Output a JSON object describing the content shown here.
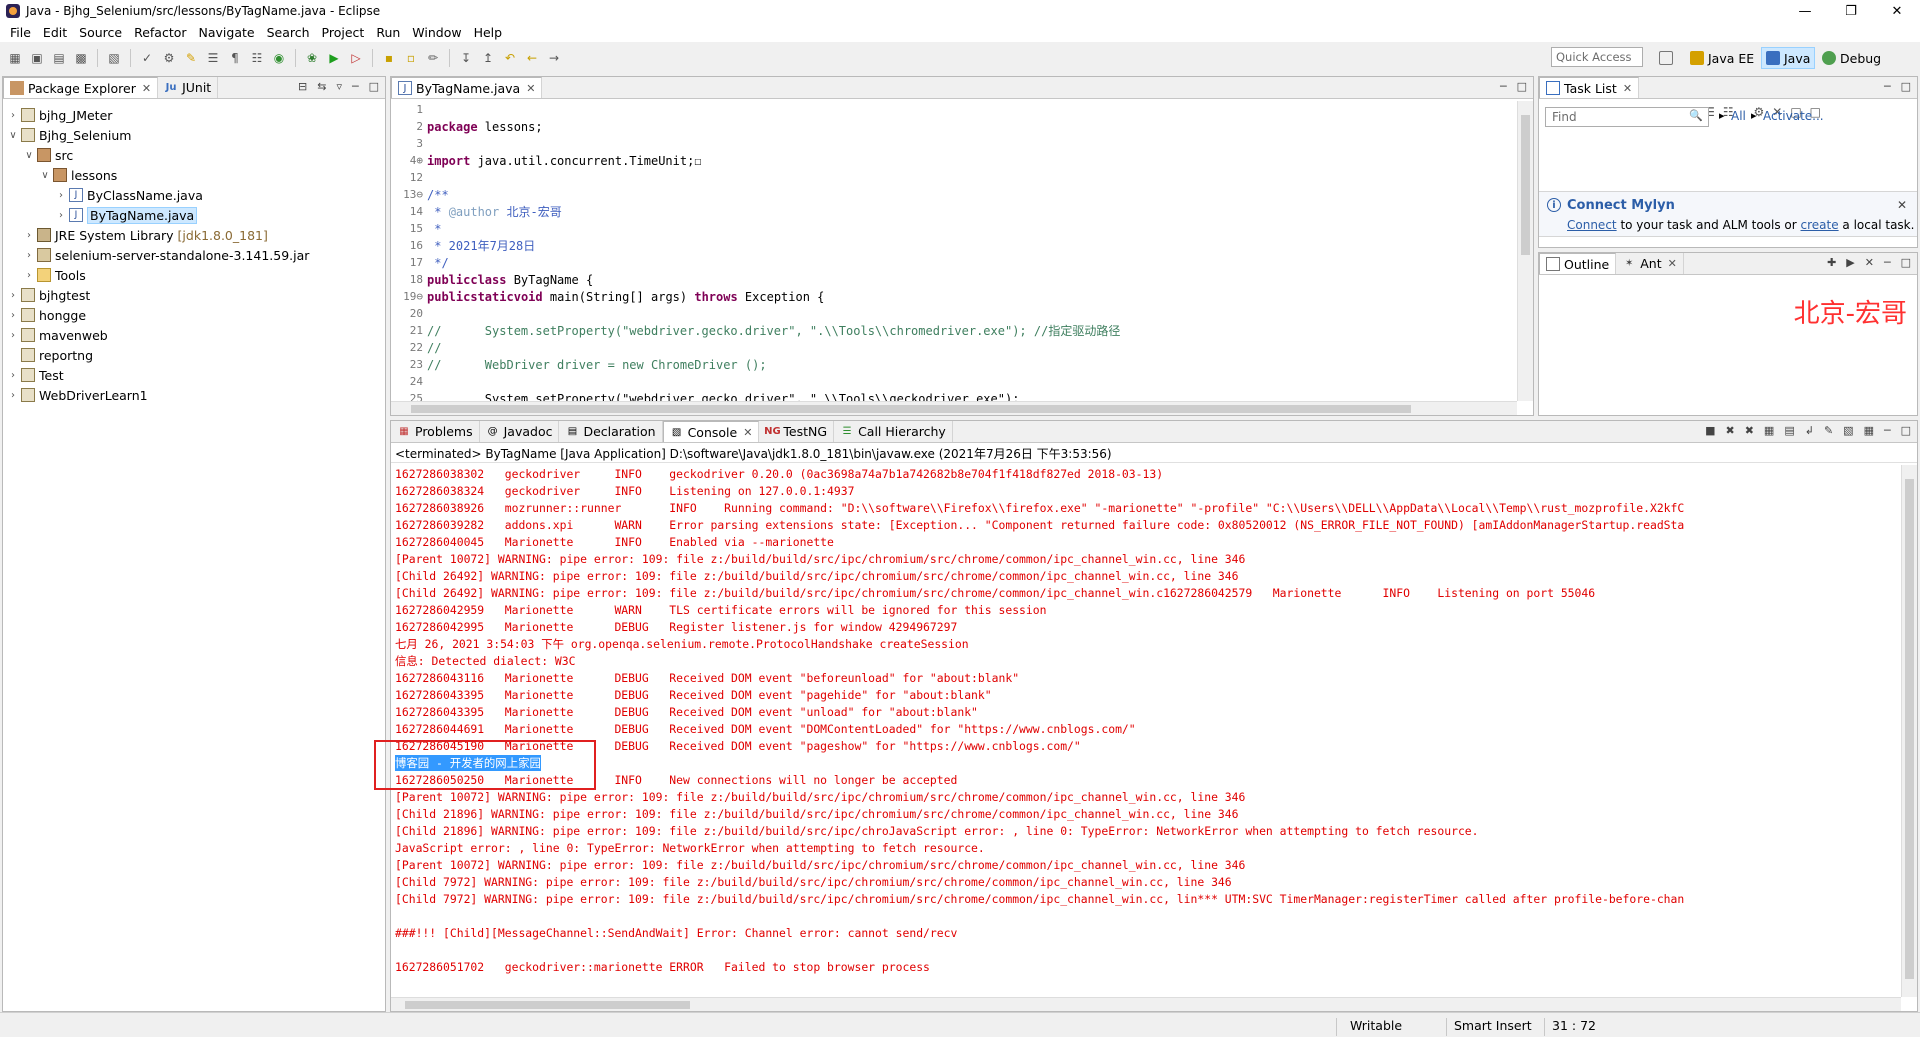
{
  "window": {
    "title": "Java - Bjhg_Selenium/src/lessons/ByTagName.java - Eclipse",
    "controls": [
      "—",
      "❐",
      "✕"
    ]
  },
  "menu": [
    "File",
    "Edit",
    "Source",
    "Refactor",
    "Navigate",
    "Search",
    "Project",
    "Run",
    "Window",
    "Help"
  ],
  "toolbar": {
    "quick_access_placeholder": "Quick Access",
    "perspectives": [
      "Java EE",
      "Java",
      "Debug"
    ]
  },
  "package_explorer": {
    "tabs": [
      "Package Explorer",
      "JUnit"
    ],
    "items": [
      {
        "label": "bjhg_JMeter",
        "depth": 0,
        "expanded": false,
        "icon": "project-icon"
      },
      {
        "label": "Bjhg_Selenium",
        "depth": 0,
        "expanded": true,
        "icon": "project-icon"
      },
      {
        "label": "src",
        "depth": 1,
        "expanded": true,
        "icon": "source-folder-icon"
      },
      {
        "label": "lessons",
        "depth": 2,
        "expanded": true,
        "icon": "package-icon"
      },
      {
        "label": "ByClassName.java",
        "depth": 3,
        "expanded": false,
        "icon": "java-file-icon"
      },
      {
        "label": "ByTagName.java",
        "depth": 3,
        "expanded": false,
        "icon": "java-file-icon",
        "selected": true
      },
      {
        "label": "JRE System Library",
        "extra": "[jdk1.8.0_181]",
        "depth": 1,
        "expanded": false,
        "icon": "library-icon"
      },
      {
        "label": "selenium-server-standalone-3.141.59.jar",
        "depth": 1,
        "expanded": false,
        "icon": "jar-icon"
      },
      {
        "label": "Tools",
        "depth": 1,
        "expanded": false,
        "icon": "folder-icon"
      },
      {
        "label": "bjhgtest",
        "depth": 0,
        "expanded": false,
        "icon": "project-icon"
      },
      {
        "label": "honggе",
        "depth": 0,
        "expanded": false,
        "icon": "project-icon"
      },
      {
        "label": "mavenweb",
        "depth": 0,
        "expanded": false,
        "icon": "project-icon"
      },
      {
        "label": "reportng",
        "depth": 0,
        "expanded": null,
        "icon": "project-icon"
      },
      {
        "label": "Test",
        "depth": 0,
        "expanded": false,
        "icon": "project-icon"
      },
      {
        "label": "WebDriverLearn1",
        "depth": 0,
        "expanded": false,
        "icon": "project-icon"
      }
    ]
  },
  "editor": {
    "tab": "ByTagName.java",
    "lines": [
      {
        "n": "1",
        "code": ""
      },
      {
        "n": "2",
        "code": "package lessons;",
        "kind": "pkg"
      },
      {
        "n": "3",
        "code": ""
      },
      {
        "n": "4⊕",
        "code": "import java.util.concurrent.TimeUnit;☐",
        "kind": "imp"
      },
      {
        "n": "12",
        "code": ""
      },
      {
        "n": "13⊖",
        "code": "/**",
        "kind": "jd"
      },
      {
        "n": "14",
        "code": " * @author 北京-宏哥",
        "kind": "jd"
      },
      {
        "n": "15",
        "code": " *",
        "kind": "jd"
      },
      {
        "n": "16",
        "code": " * 2021年7月28日",
        "kind": "jd"
      },
      {
        "n": "17",
        "code": " */",
        "kind": "jd"
      },
      {
        "n": "18",
        "code": "public class ByTagName {",
        "kind": "cls"
      },
      {
        "n": "19⊖",
        "code": "    public static void main(String[] args) throws Exception {",
        "kind": "main"
      },
      {
        "n": "20",
        "code": ""
      },
      {
        "n": "21",
        "code": "//      System.setProperty(\"webdriver.gecko.driver\", \".\\\\Tools\\\\chromedriver.exe\"); //指定驱动路径",
        "kind": "cm"
      },
      {
        "n": "22",
        "code": "//",
        "kind": "cm"
      },
      {
        "n": "23",
        "code": "//      WebDriver driver = new ChromeDriver ();",
        "kind": "cm"
      },
      {
        "n": "24",
        "code": ""
      },
      {
        "n": "25",
        "code": "        System.setProperty(\"webdriver.gecko.driver\", \".\\\\Tools\\\\geckodriver.exe\");"
      }
    ]
  },
  "console": {
    "tabs": [
      "Problems",
      "Javadoc",
      "Declaration",
      "Console",
      "TestNG",
      "Call Hierarchy"
    ],
    "header": "<terminated> ByTagName [Java Application] D:\\software\\Java\\jdk1.8.0_181\\bin\\javaw.exe (2021年7月26日 下午3:53:56)",
    "lines": [
      "1627286038302   geckodriver     INFO    geckodriver 0.20.0 (0ac3698a74a7b1a742682b8e704f1f418df827ed 2018-03-13)",
      "1627286038324   geckodriver     INFO    Listening on 127.0.0.1:4937",
      "1627286038926   mozrunner::runner       INFO    Running command: \"D:\\\\software\\\\Firefox\\\\firefox.exe\" \"-marionette\" \"-profile\" \"C:\\\\Users\\\\DELL\\\\AppData\\\\Local\\\\Temp\\\\rust_mozprofile.X2kfC",
      "1627286039282   addons.xpi      WARN    Error parsing extensions state: [Exception... \"Component returned failure code: 0x80520012 (NS_ERROR_FILE_NOT_FOUND) [amIAddonManagerStartup.readSta",
      "1627286040045   Marionette      INFO    Enabled via --marionette",
      "[Parent 10072] WARNING: pipe error: 109: file z:/build/build/src/ipc/chromium/src/chrome/common/ipc_channel_win.cc, line 346",
      "[Child 26492] WARNING: pipe error: 109: file z:/build/build/src/ipc/chromium/src/chrome/common/ipc_channel_win.cc, line 346",
      "[Child 26492] WARNING: pipe error: 109: file z:/build/build/src/ipc/chromium/src/chrome/common/ipc_channel_win.c1627286042579   Marionette      INFO    Listening on port 55046",
      "1627286042959   Marionette      WARN    TLS certificate errors will be ignored for this session",
      "1627286042995   Marionette      DEBUG   Register listener.js for window 4294967297",
      "七月 26, 2021 3:54:03 下午 org.openqa.selenium.remote.ProtocolHandshake createSession",
      "信息: Detected dialect: W3C",
      "1627286043116   Marionette      DEBUG   Received DOM event \"beforeunload\" for \"about:blank\"",
      "1627286043395   Marionette      DEBUG   Received DOM event \"pagehide\" for \"about:blank\"",
      "1627286043395   Marionette      DEBUG   Received DOM event \"unload\" for \"about:blank\"",
      "1627286044691   Marionette      DEBUG   Received DOM event \"DOMContentLoaded\" for \"https://www.cnblogs.com/\"",
      "1627286045190   Marionette      DEBUG   Received DOM event \"pageshow\" for \"https://www.cnblogs.com/\"",
      "博客园 - 开发者的网上家园",
      "1627286050250   Marionette      INFO    New connections will no longer be accepted",
      "[Parent 10072] WARNING: pipe error: 109: file z:/build/build/src/ipc/chromium/src/chrome/common/ipc_channel_win.cc, line 346",
      "[Child 21896] WARNING: pipe error: 109: file z:/build/build/src/ipc/chromium/src/chrome/common/ipc_channel_win.cc, line 346",
      "[Child 21896] WARNING: pipe error: 109: file z:/build/build/src/ipc/chroJavaScript error: , line 0: TypeError: NetworkError when attempting to fetch resource.",
      "JavaScript error: , line 0: TypeError: NetworkError when attempting to fetch resource.",
      "[Parent 10072] WARNING: pipe error: 109: file z:/build/build/src/ipc/chromium/src/chrome/common/ipc_channel_win.cc, line 346",
      "[Child 7972] WARNING: pipe error: 109: file z:/build/build/src/ipc/chromium/src/chrome/common/ipc_channel_win.cc, line 346",
      "[Child 7972] WARNING: pipe error: 109: file z:/build/build/src/ipc/chromium/src/chrome/common/ipc_channel_win.cc, lin*** UTM:SVC TimerManager:registerTimer called after profile-before-chan",
      "",
      "###!!! [Child][MessageChannel::SendAndWait] Error: Channel error: cannot send/recv",
      "",
      "1627286051702   geckodriver::marionette ERROR   Failed to stop browser process"
    ],
    "highlighted_index": 17
  },
  "task_list": {
    "tab": "Task List",
    "find_placeholder": "Find",
    "all_label": "All",
    "activate_label": "Activate...",
    "mylyn_title": "Connect Mylyn",
    "mylyn_connect": "Connect",
    "mylyn_text_1": " to your task and ALM tools or ",
    "mylyn_create": "create",
    "mylyn_text_2": " a local task."
  },
  "outline": {
    "tabs": [
      "Outline",
      "Ant"
    ],
    "watermark": "北京-宏哥"
  },
  "status_bar": {
    "writable": "Writable",
    "insert_mode": "Smart Insert",
    "position": "31 : 72"
  },
  "colors": {
    "console_text": "#e00000",
    "selection": "#3399ff",
    "keyword": "#7f0055",
    "comment": "#3f7f5f",
    "javadoc": "#3f5fbf"
  }
}
